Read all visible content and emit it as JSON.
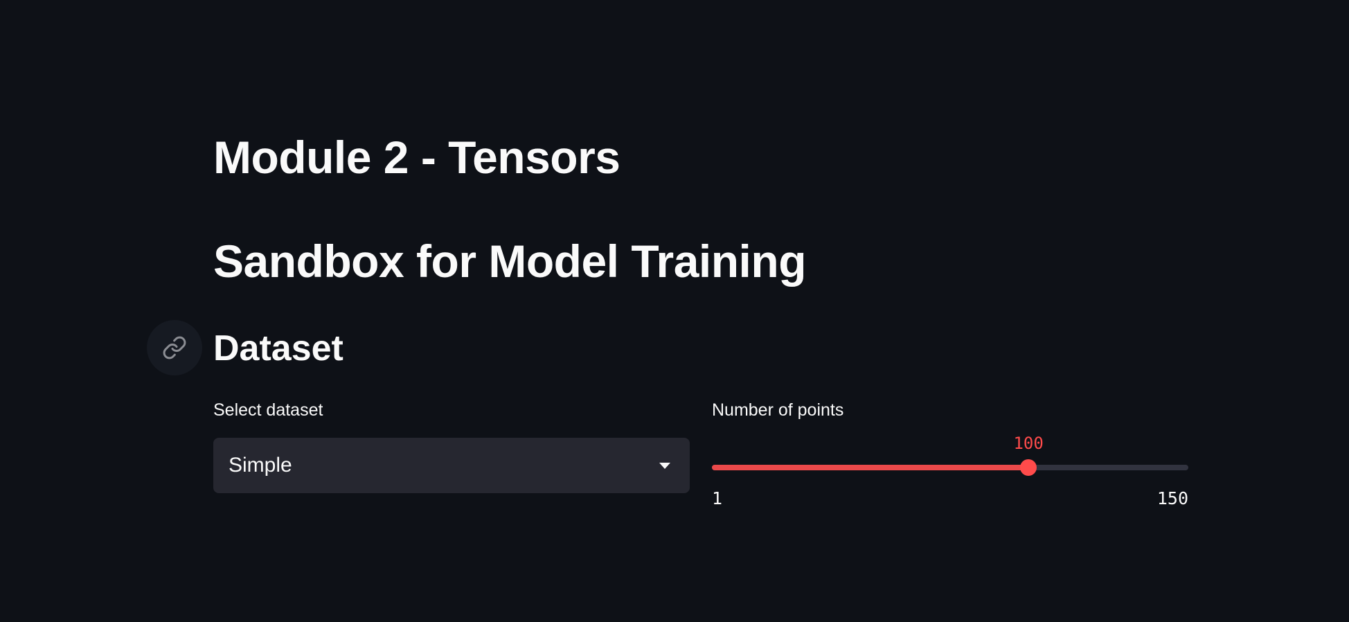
{
  "titles": {
    "module": "Module 2 - Tensors",
    "sandbox": "Sandbox for Model Training"
  },
  "section": {
    "header": "Dataset",
    "anchor_icon": "link-icon"
  },
  "dataset_select": {
    "label": "Select dataset",
    "value": "Simple"
  },
  "points_slider": {
    "label": "Number of points",
    "value": 100,
    "min": 1,
    "max": 150
  },
  "colors": {
    "background": "#0e1117",
    "accent": "#ff4b4b",
    "widget_bg": "#262730"
  }
}
